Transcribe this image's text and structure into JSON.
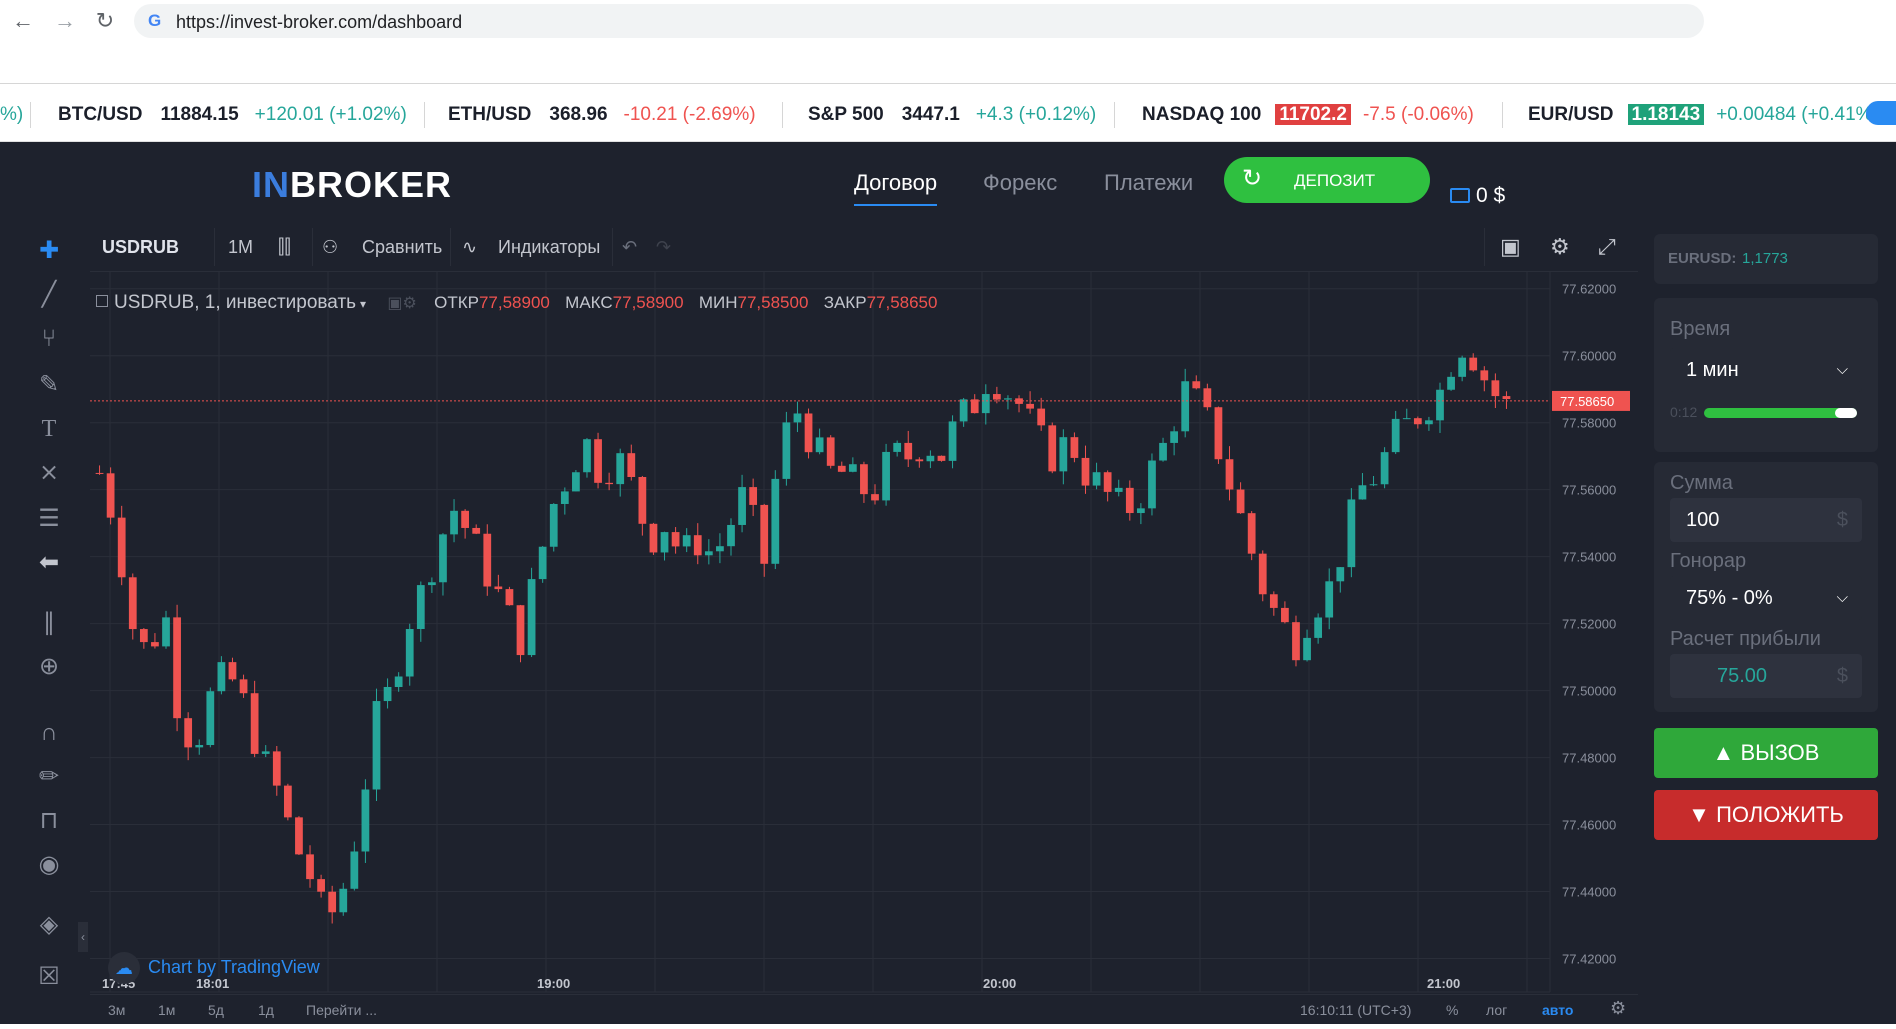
{
  "browser": {
    "back_icon": "arrow-left-icon",
    "forward_icon": "arrow-right-icon",
    "reload_icon": "reload-icon",
    "url": "https://invest-broker.com/dashboard"
  },
  "ticker": [
    {
      "lead": "%)",
      "symbol": "",
      "price": "",
      "change": "",
      "dir": "up",
      "hl": ""
    },
    {
      "symbol": "BTC/USD",
      "price": "11884.15",
      "change": "+120.01 (+1.02%)",
      "dir": "up",
      "hl": ""
    },
    {
      "symbol": "ETH/USD",
      "price": "368.96",
      "change": "-10.21 (-2.69%)",
      "dir": "down",
      "hl": ""
    },
    {
      "symbol": "S&P 500",
      "price": "3447.1",
      "change": "+4.3 (+0.12%)",
      "dir": "up",
      "hl": ""
    },
    {
      "symbol": "NASDAQ 100",
      "price": "11702.2",
      "change": "-7.5 (-0.06%)",
      "dir": "down",
      "hl": "red"
    },
    {
      "symbol": "EUR/USD",
      "price": "1.18143",
      "change": "+0.00484 (+0.41%",
      "dir": "up",
      "hl": "green"
    }
  ],
  "header": {
    "logo_in": "IN",
    "logo_rest": "BROKER",
    "nav": [
      {
        "label": "Договор",
        "active": true
      },
      {
        "label": "Форекс",
        "active": false
      },
      {
        "label": "Платежи",
        "active": false
      }
    ],
    "deposit_label": "Депозит",
    "deposit_icon": "refresh-icon",
    "balance": "0 $"
  },
  "toolbar": {
    "symbol": "USDRUB",
    "interval": "1M",
    "compare": "Сравнить",
    "indicators": "Индикаторы"
  },
  "legend": {
    "title": "USDRUB, 1, инвестировать",
    "open_label": "ОТКР",
    "open": "77,58900",
    "high_label": "МАКС",
    "high": "77,58900",
    "low_label": "МИН",
    "low": "77,58500",
    "close_label": "ЗАКР",
    "close": "77,58650"
  },
  "watermark": "Chart by TradingView",
  "bottombar": {
    "ranges": [
      "3м",
      "1м",
      "5д",
      "1д"
    ],
    "goto": "Перейти ...",
    "clock": "16:10:11 (UTC+3)",
    "percent": "%",
    "log": "лог",
    "auto": "авто"
  },
  "right_panel": {
    "pair_label": "EURUSD:",
    "pair_value": "1,1773",
    "time_label": "Время",
    "time_value": "1 мин",
    "timer_text": "0:12",
    "timer_progress": 0.97,
    "amount_label": "Сумма",
    "amount_value": "100",
    "amount_currency": "$",
    "fee_label": "Гонорар",
    "fee_value": "75% - 0%",
    "profit_label": "Расчет прибыли",
    "profit_value": "75.00",
    "profit_currency": "$",
    "call_label": "ВЫЗОВ",
    "put_label": "ПОЛОЖИТЬ"
  },
  "chart_data": {
    "type": "candlestick",
    "symbol": "USDRUB",
    "interval": "1",
    "ylim": [
      77.41,
      77.625
    ],
    "y_ticks": [
      "77.62000",
      "77.60000",
      "77.58000",
      "77.56000",
      "77.54000",
      "77.52000",
      "77.50000",
      "77.48000",
      "77.46000",
      "77.44000",
      "77.42000"
    ],
    "x_ticks": [
      "17:45",
      "18:01",
      "19:00",
      "20:00",
      "21:00"
    ],
    "last_price": "77.58650",
    "colors": {
      "up": "#26a69a",
      "down": "#ef5350",
      "background": "#1e222d",
      "grid": "#2a2e39"
    },
    "close_path": [
      77.565,
      77.55,
      77.52,
      77.51,
      77.525,
      77.49,
      77.485,
      77.5,
      77.505,
      77.495,
      77.48,
      77.47,
      77.455,
      77.445,
      77.43,
      77.44,
      77.46,
      77.49,
      77.5,
      77.52,
      77.53,
      77.545,
      77.555,
      77.545,
      77.535,
      77.525,
      77.515,
      77.535,
      77.555,
      77.565,
      77.575,
      77.565,
      77.57,
      77.56,
      77.545,
      77.55,
      77.54,
      77.545,
      77.54,
      77.55,
      77.56,
      77.535,
      77.57,
      77.585,
      77.575,
      77.565,
      77.565,
      77.56,
      77.56,
      77.57,
      77.57,
      77.575,
      77.57,
      77.58,
      77.585,
      77.595,
      77.59,
      77.585,
      77.575,
      77.57,
      77.575,
      77.565,
      77.56,
      77.555,
      77.555,
      77.565,
      77.575,
      77.59,
      77.585,
      77.575,
      77.56,
      77.545,
      77.53,
      77.52,
      77.515,
      77.525,
      77.53,
      77.545,
      77.56,
      77.565,
      77.575,
      77.58,
      77.585,
      77.59,
      77.605,
      77.6,
      77.59,
      77.585
    ]
  }
}
